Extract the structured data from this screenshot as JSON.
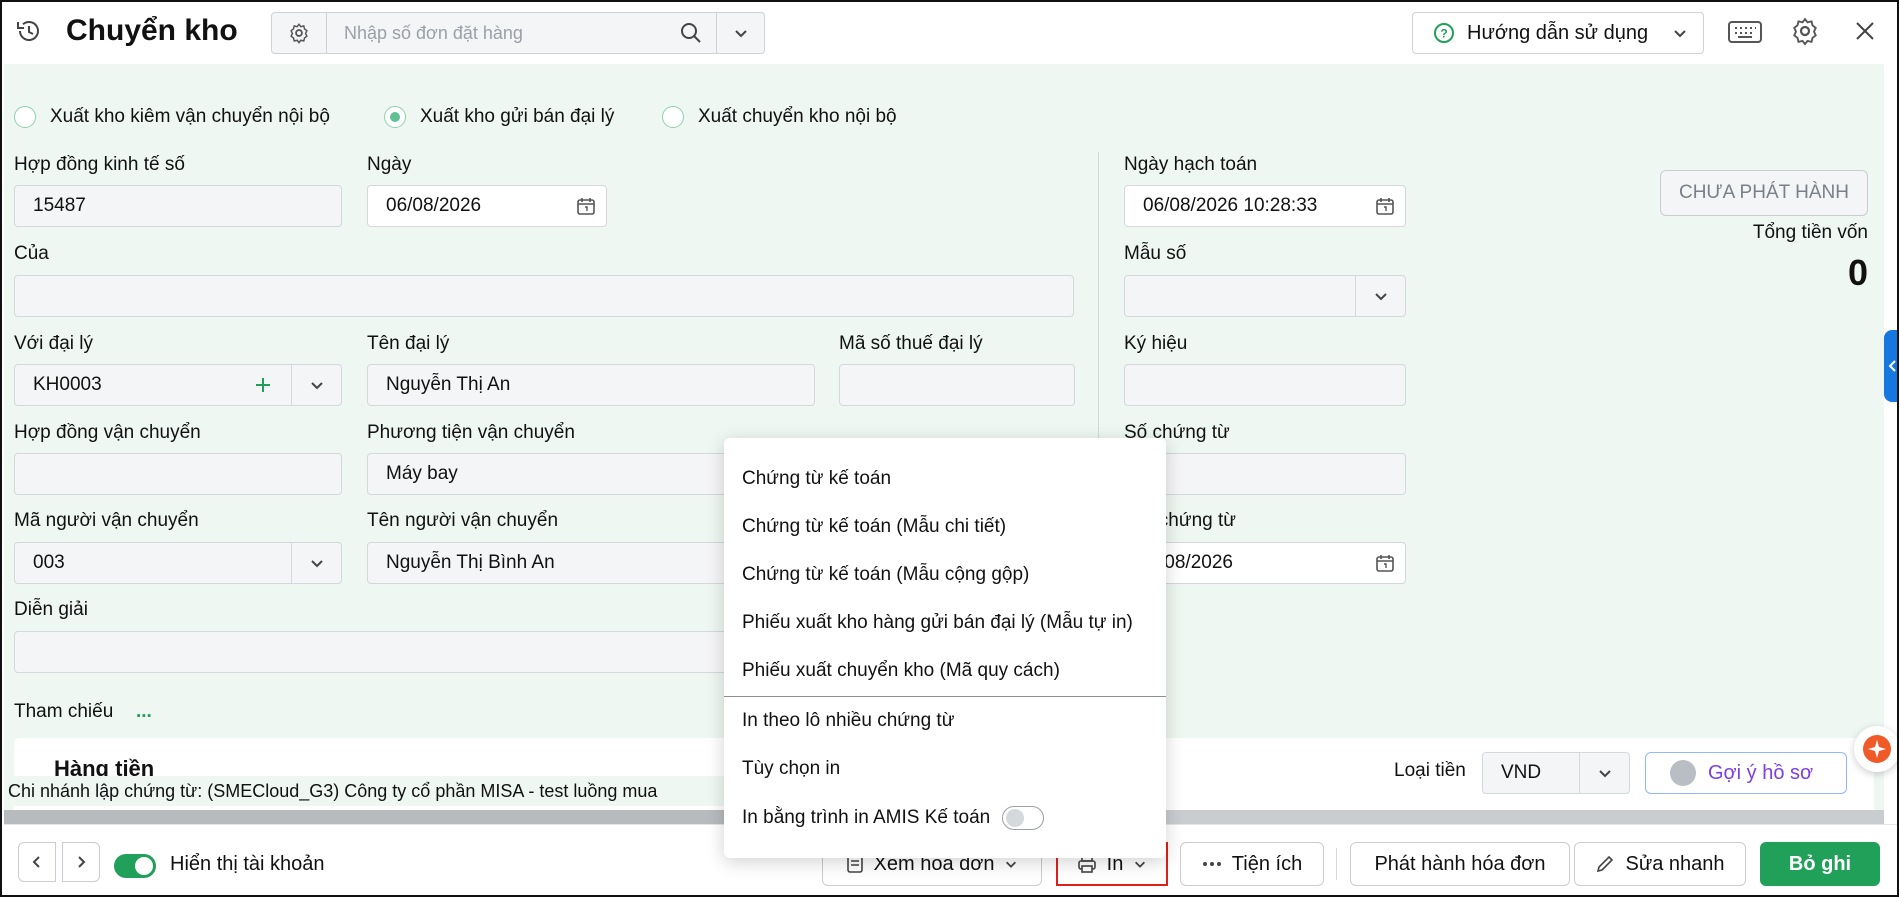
{
  "header": {
    "title": "Chuyển kho",
    "search_placeholder": "Nhập số đơn đặt hàng",
    "help_label": "Hướng dẫn sử dụng"
  },
  "radios": [
    {
      "label": "Xuất kho kiêm vận chuyển nội bộ",
      "selected": false
    },
    {
      "label": "Xuất kho gửi bán đại lý",
      "selected": true
    },
    {
      "label": "Xuất chuyển kho nội bộ",
      "selected": false
    }
  ],
  "form": {
    "contract_no_label": "Hợp đồng kinh tế số",
    "contract_no_value": "15487",
    "date_label": "Ngày",
    "date_value": "06/08/2026",
    "of_label": "Của",
    "of_value": "",
    "agent_label": "Với đại lý",
    "agent_value": "KH0003",
    "agent_name_label": "Tên đại lý",
    "agent_name_value": "Nguyễn Thị An",
    "agent_tax_label": "Mã số thuế đại lý",
    "agent_tax_value": "",
    "transport_contract_label": "Hợp đồng vận chuyển",
    "transport_contract_value": "",
    "vehicle_label": "Phương tiện vận chuyển",
    "vehicle_value": "Máy bay",
    "carrier_code_label": "Mã người vận chuyển",
    "carrier_code_value": "003",
    "carrier_name_label": "Tên người vận chuyển",
    "carrier_name_value": "Nguyễn Thị Bình An",
    "desc_label": "Diễn giải",
    "desc_value": "",
    "ref_label": "Tham chiếu",
    "ref_more": "...",
    "posting_date_label": "Ngày hạch toán",
    "posting_date_value": "06/08/2026 10:28:33",
    "template_label": "Mẫu số",
    "template_value": "",
    "symbol_label": "Ký hiệu",
    "symbol_value": "",
    "voucher_no_label": "Số chứng từ",
    "voucher_no_value": "",
    "voucher_date_label": "y chứng từ",
    "voucher_date_value": "/08/2026"
  },
  "status": {
    "badge": "CHƯA PHÁT HÀNH",
    "total_label": "Tổng tiền vốn",
    "total_value": "0"
  },
  "grid": {
    "tab_label": "Hàng tiền",
    "currency_label": "Loại tiền",
    "currency_value": "VND",
    "suggest_label": "Gợi ý hồ sơ"
  },
  "branch_text": "Chi nhánh lập chứng từ: (SMECloud_G3) Công ty cổ phần MISA - test luồng mua",
  "footer": {
    "show_account_label": "Hiển thị tài khoản",
    "view_invoice_label": "Xem hóa đơn",
    "print_label": "In",
    "utility_label": "Tiện ích",
    "issue_invoice_label": "Phát hành hóa đơn",
    "quick_edit_label": "Sửa nhanh",
    "unpost_label": "Bỏ ghi"
  },
  "print_menu": {
    "items": [
      "Chứng từ kế toán",
      "Chứng từ kế toán (Mẫu chi tiết)",
      "Chứng từ kế toán (Mẫu cộng gộp)",
      "Phiếu xuất kho hàng gửi bán đại lý (Mẫu tự in)",
      "Phiếu xuất chuyển kho (Mã quy cách)"
    ],
    "batch_label": "In theo lô nhiều chứng từ",
    "options_label": "Tùy chọn in",
    "amis_printer_label": "In bằng trình in AMIS Kế toán",
    "amis_printer_on": false
  },
  "colors": {
    "accent": "#21a05a",
    "form_bg": "#eef7f2",
    "highlight_border": "#e0201b",
    "side_tab": "#1677e0"
  }
}
